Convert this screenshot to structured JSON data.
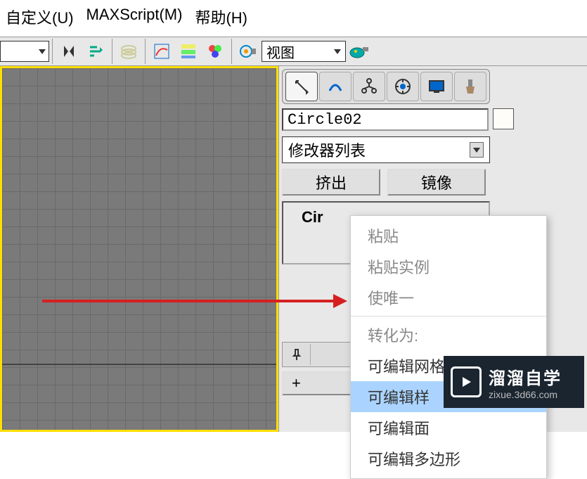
{
  "menubar": {
    "customize": "自定义(U)",
    "maxscript": "MAXScript(M)",
    "help": "帮助(H)"
  },
  "toolbar": {
    "view_label": "视图"
  },
  "panel": {
    "object_name": "Circle02",
    "modifier_list_label": "修改器列表",
    "extrude": "挤出",
    "mirror": "镜像",
    "stack_item": "Cir",
    "rollup_plus": "+"
  },
  "context_menu": {
    "paste": "粘贴",
    "paste_instance": "粘贴实例",
    "make_unique": "使唯一",
    "convert_to": "转化为:",
    "editable_mesh": "可编辑网格",
    "editable_spline": "可编辑样",
    "editable_patch": "可编辑面",
    "editable_poly": "可编辑多边形"
  },
  "watermark": {
    "title": "溜溜自学",
    "sub": "zixue.3d66.com"
  }
}
